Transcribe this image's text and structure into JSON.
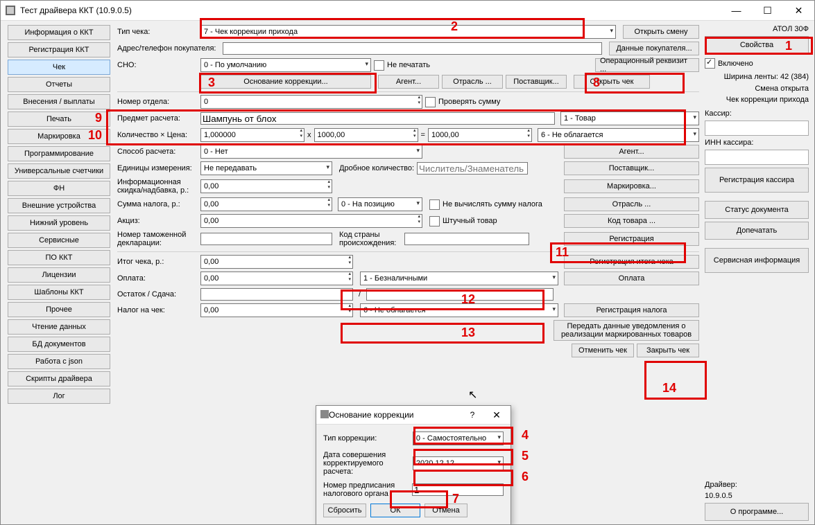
{
  "window": {
    "title": "Тест драйвера ККТ (10.9.0.5)"
  },
  "nav": [
    "Информация о ККТ",
    "Регистрация ККТ",
    "Чек",
    "Отчеты",
    "Внесения / выплаты",
    "Печать",
    "Маркировка",
    "Программирование",
    "Универсальные счетчики",
    "ФН",
    "Внешние устройства",
    "Нижний уровень",
    "Сервисные",
    "ПО ККТ",
    "Лицензии",
    "Шаблоны ККТ",
    "Прочее",
    "Чтение данных",
    "БД документов",
    "Работа с json",
    "Скрипты драйвера",
    "Лог"
  ],
  "nav_active": 2,
  "labels": {
    "tipCheka": "Тип чека:",
    "adres": "Адрес/телефон покупателя:",
    "sno": "СНО:",
    "nePechat": "Не печатать",
    "osnKorr": "Основание коррекции...",
    "agent": "Агент...",
    "otrasl": "Отрасль ...",
    "postav": "Поставщик...",
    "openCheck": "Открыть чек",
    "openShift": "Открыть смену",
    "buyerData": "Данные покупателя...",
    "operReq": "Операционный реквизит ...",
    "nomerOtd": "Номер отдела:",
    "proverSum": "Проверять сумму",
    "predmet": "Предмет расчета:",
    "kolCena": "Количество × Цена:",
    "sposob": "Способ расчета:",
    "edIzm": "Единицы измерения:",
    "drobKol": "Дробное количество:",
    "drobPh": "Числитель/Знаменатель",
    "infSk": "Информационная скидка/надбавка, р.:",
    "sumNal": "Сумма налога, р.:",
    "neVych": "Не вычислять сумму налога",
    "akciz": "Акциз:",
    "shtuch": "Штучный товар",
    "nomTam": "Номер таможенной декларации:",
    "kodStr": "Код страны происхождения:",
    "itog": "Итог чека, р.:",
    "oplata": "Оплата:",
    "ostatok": "Остаток / Сдача:",
    "nalogCh": "Налог на чек:",
    "agentBtn": "Агент...",
    "postavBtn": "Поставщик...",
    "markBtn": "Маркировка...",
    "otraslBtn": "Отрасль ...",
    "kodTov": "Код товара ...",
    "reg": "Регистрация",
    "regItog": "Регистрация итога чека",
    "oplataBtn": "Оплата",
    "regNalog": "Регистрация налога",
    "peredat": "Передать данные уведомления о реализации маркированных товаров",
    "cancel": "Отменить чек",
    "close": "Закрыть чек"
  },
  "values": {
    "tipCheka": "7 - Чек коррекции прихода",
    "sno": "0 - По умолчанию",
    "nomerOtd": "0",
    "predmet": "Шампунь от блох",
    "predType": "1 - Товар",
    "qty": "1,000000",
    "price": "1000,00",
    "total": "1000,00",
    "tax": "6 - Не облагается",
    "sposob": "0 - Нет",
    "edIzm": "Не передавать",
    "infSk": "0,00",
    "sumNal": "0,00",
    "sumNalSel": "0 - На позицию",
    "akciz": "0,00",
    "itog": "0,00",
    "oplata": "0,00",
    "oplataSel": "1 - Безналичными",
    "nalogCh": "0,00",
    "nalogSel": "6 - Не облагается",
    "x": "x",
    "eq": "=",
    "slash": "/"
  },
  "right": {
    "device": "АТОЛ 30Ф",
    "props": "Свойства",
    "vkl": "Включено",
    "shirina": "Ширина ленты: 42 (384)",
    "smena": "Смена открыта",
    "chekKor": "Чек коррекции прихода",
    "kassir": "Кассир:",
    "inn": "ИНН кассира:",
    "regKassir": "Регистрация кассира",
    "status": "Статус документа",
    "dopech": "Допечатать",
    "serv": "Сервисная информация",
    "driver": "Драйвер:",
    "ver": "10.9.0.5",
    "about": "О программе..."
  },
  "dialog": {
    "title": "Основание коррекции",
    "tipKor": "Тип коррекции:",
    "tipKorVal": "0 - Самостоятельно",
    "data": "Дата совершения корректируемого расчета:",
    "dataVal": "2020.12.12",
    "nomer": "Номер предписания налогового органа",
    "nomerVal": "1",
    "reset": "Сбросить",
    "ok": "ОК",
    "cancel": "Отмена"
  }
}
